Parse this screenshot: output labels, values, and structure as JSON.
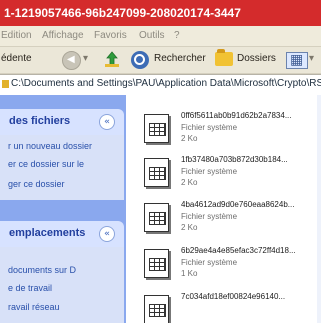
{
  "window": {
    "title": "1-1219057466-96b247099-208020174-3447"
  },
  "menu": {
    "items": [
      "Edition",
      "Affichage",
      "Favoris",
      "Outils",
      "?"
    ]
  },
  "toolbar": {
    "back": "édente",
    "search": "Rechercher",
    "folders": "Dossiers"
  },
  "address": {
    "path": "C:\\Documents and Settings\\PAU\\Application Data\\Microsoft\\Crypto\\RSA\\S"
  },
  "sidebar": {
    "file_tasks": {
      "title": "des fichiers",
      "items": [
        "r un nouveau dossier",
        "er ce dossier sur le",
        "ger ce dossier"
      ]
    },
    "other_places": {
      "title": "emplacements",
      "items": [
        "documents sur D",
        "e de travail",
        "ravail réseau"
      ]
    }
  },
  "files": [
    {
      "name": "0ff6f5611ab0b91d62b2a7834...",
      "type": "Fichier système",
      "size": "2 Ko"
    },
    {
      "name": "1fb37480a703b872d30b184...",
      "type": "Fichier système",
      "size": "2 Ko"
    },
    {
      "name": "4ba4612ad9d0e760eaa8624b...",
      "type": "Fichier système",
      "size": "2 Ko"
    },
    {
      "name": "6b29ae4a4e85efac3c72ff4d18...",
      "type": "Fichier système",
      "size": "1 Ko"
    },
    {
      "name": "7c034afd18ef00824e96140...",
      "type": "",
      "size": ""
    }
  ],
  "colors": {
    "accent": "#d42b2c",
    "sidebar": "#8aa8ee",
    "sidebar_panel": "#d8e1f8"
  }
}
